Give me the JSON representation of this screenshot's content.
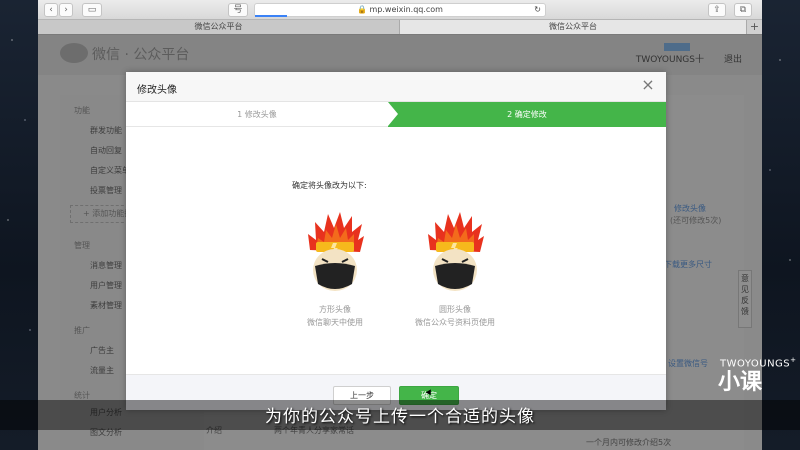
{
  "browser": {
    "url": "mp.weixin.qq.com",
    "reader_button": "号",
    "tabs": [
      {
        "label": "微信公众平台"
      },
      {
        "label": "微信公众平台"
      }
    ],
    "new_tab": "+"
  },
  "page": {
    "site_title": "微信 · 公众平台",
    "account_name": "TWOYOUNGS十",
    "logout": "退出",
    "sidebar": {
      "section1": "功能",
      "items1": [
        "群发功能",
        "自动回复",
        "自定义菜单",
        "投票管理"
      ],
      "add_plugin": "+ 添加功能插件",
      "section2": "管理",
      "items2": [
        "消息管理",
        "用户管理",
        "素材管理"
      ],
      "section3": "推广",
      "items3": [
        "广告主",
        "流量主"
      ],
      "section4": "统计",
      "items4": [
        "用户分析",
        "图文分析"
      ]
    },
    "right_links": [
      "修改头像",
      "(还可修改5次)",
      "下载更多尺寸",
      "设置微信号"
    ],
    "feedback": "意见反馈",
    "bottom_row": {
      "label": "介绍",
      "value": "两个年青人分享家常话",
      "note": "一个月内可修改介绍5次"
    }
  },
  "modal": {
    "title": "修改头像",
    "close": "×",
    "steps": [
      {
        "label": "1 修改头像",
        "active": false
      },
      {
        "label": "2 确定修改",
        "active": true
      }
    ],
    "confirm_text": "确定将头像改为以下:",
    "avatars": [
      {
        "shape": "方形头像",
        "usage": "微信聊天中使用"
      },
      {
        "shape": "圆形头像",
        "usage": "微信公众号资料页使用"
      }
    ],
    "prev_button": "上一步",
    "confirm_button": "确定",
    "accent": "#44b549"
  },
  "overlay": {
    "subtitle": "为你的公众号上传一个合适的头像",
    "brand": "TWOYOUNGS",
    "brand_sup": "+",
    "brand_mark": "小课"
  }
}
